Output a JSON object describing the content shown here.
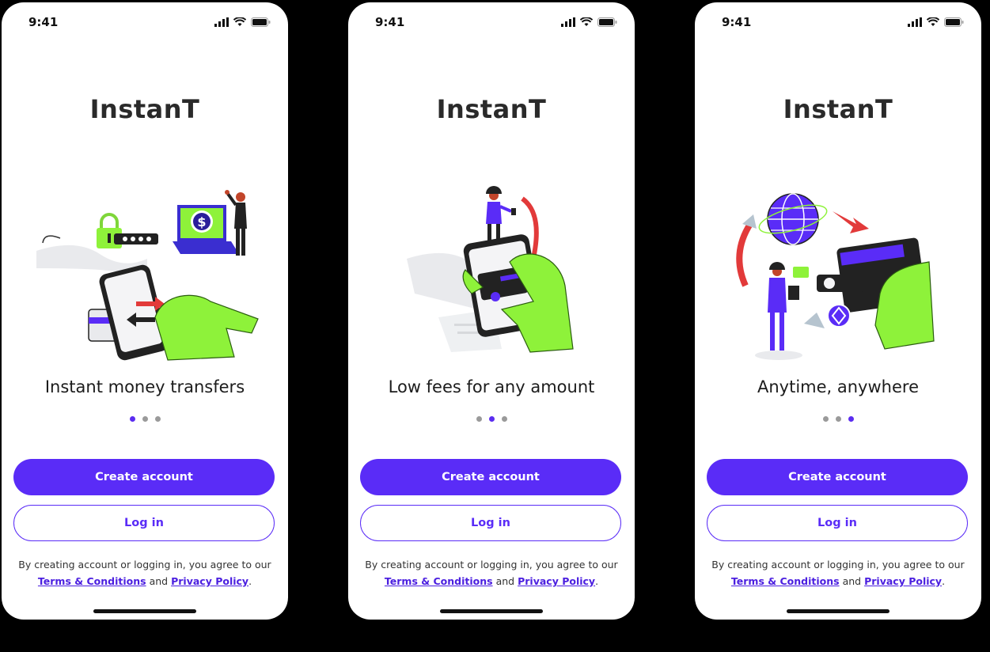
{
  "status": {
    "time": "9:41"
  },
  "app": {
    "name": "InstanT"
  },
  "screens": [
    {
      "caption": "Instant money transfers",
      "active_dot": 0
    },
    {
      "caption": "Low fees for any amount",
      "active_dot": 1
    },
    {
      "caption": "Anytime, anywhere",
      "active_dot": 2
    }
  ],
  "buttons": {
    "create": "Create account",
    "login": "Log in"
  },
  "legal": {
    "prefix": "By creating account or logging in, you agree to our",
    "terms": "Terms & Conditions",
    "and": "and",
    "privacy": "Privacy Policy",
    "suffix": "."
  },
  "colors": {
    "accent": "#5a2cf7",
    "lime": "#8ef23a",
    "red": "#e23a3a",
    "dot_inactive": "#9a9a9a"
  },
  "icons": [
    "signal-icon",
    "wifi-icon",
    "battery-icon"
  ]
}
